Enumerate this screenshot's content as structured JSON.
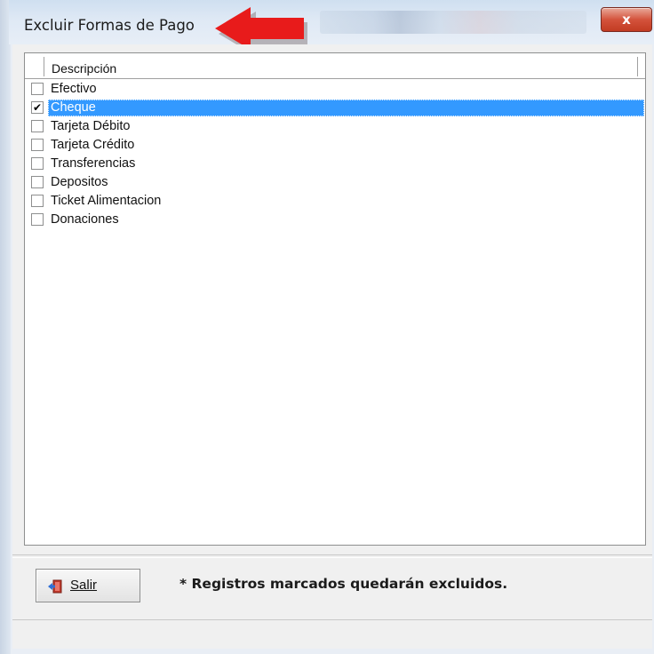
{
  "window": {
    "title": "Excluir Formas de Pago",
    "close_glyph": "x",
    "accent_arrow_color": "#e81b1b",
    "selection_color": "#3399ff"
  },
  "list": {
    "column_header": "Descripción",
    "items": [
      {
        "label": "Efectivo",
        "checked": false,
        "selected": false
      },
      {
        "label": "Cheque",
        "checked": true,
        "selected": true
      },
      {
        "label": "Tarjeta Débito",
        "checked": false,
        "selected": false
      },
      {
        "label": "Tarjeta Crédito",
        "checked": false,
        "selected": false
      },
      {
        "label": "Transferencias",
        "checked": false,
        "selected": false
      },
      {
        "label": "Depositos",
        "checked": false,
        "selected": false
      },
      {
        "label": "Ticket Alimentacion",
        "checked": false,
        "selected": false
      },
      {
        "label": "Donaciones",
        "checked": false,
        "selected": false
      }
    ]
  },
  "footer": {
    "salir_label": "Salir",
    "salir_icon": "exit-door-icon",
    "note": "* Registros marcados quedarán excluidos."
  }
}
